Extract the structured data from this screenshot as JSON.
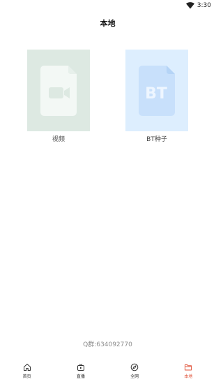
{
  "status_bar": {
    "time": "3:30",
    "wifi_icon": "wifi-icon"
  },
  "header": {
    "title": "本地"
  },
  "tiles": [
    {
      "label": "视频",
      "icon": "video-file-icon",
      "bg_color": "#dde9e2",
      "icon_color": "#f3f8f5"
    },
    {
      "label": "BT种子",
      "icon": "bt-file-icon",
      "icon_text": "BT",
      "bg_color": "#ddeefe",
      "icon_color": "#c8e0fb"
    }
  ],
  "footer": {
    "qq_text": "Q群:634092770"
  },
  "bottom_nav": {
    "items": [
      {
        "label": "首页",
        "icon": "home-icon",
        "active": false
      },
      {
        "label": "直播",
        "icon": "tv-icon",
        "active": false
      },
      {
        "label": "全网",
        "icon": "compass-icon",
        "active": false
      },
      {
        "label": "本地",
        "icon": "folder-icon",
        "active": true
      }
    ],
    "active_color": "#e0533a"
  }
}
